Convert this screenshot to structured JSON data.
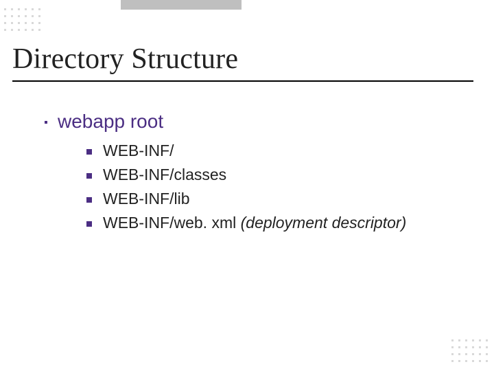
{
  "title": "Directory Structure",
  "level1": {
    "text": "webapp root"
  },
  "level2": [
    {
      "text": "WEB-INF/",
      "suffix": ""
    },
    {
      "text": "WEB-INF/classes",
      "suffix": ""
    },
    {
      "text": "WEB-INF/lib",
      "suffix": ""
    },
    {
      "text": "WEB-INF/web. xml ",
      "suffix": "(deployment descriptor)"
    }
  ]
}
